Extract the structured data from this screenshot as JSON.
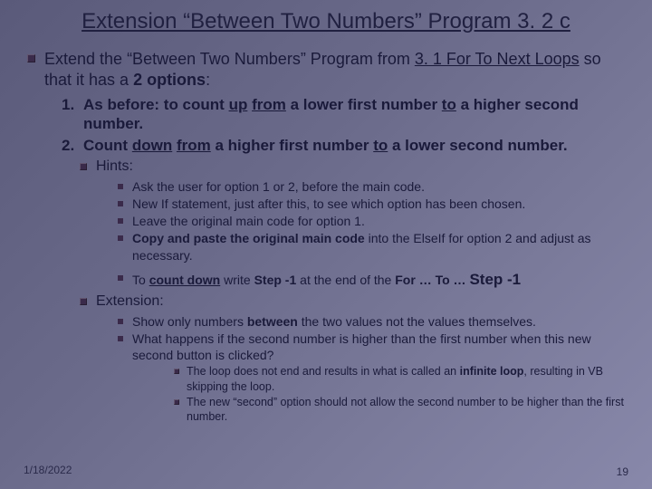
{
  "title": "Extension “Between Two Numbers” Program 3. 2 c",
  "intro": {
    "prefix": "Extend the “Between Two Numbers” Program from ",
    "link": "3. 1 For To Next Loops",
    "mid": " so that it has a ",
    "bold": "2 options",
    "suffix": ":"
  },
  "options": [
    {
      "num": "1.",
      "pre": "As before: to count ",
      "u1": "up",
      "sp1": " ",
      "u2": "from",
      "mid": " a lower first number ",
      "u3": "to",
      "post": " a higher second number."
    },
    {
      "num": "2.",
      "pre": "Count ",
      "u1": "down",
      "sp1": " ",
      "u2": "from",
      "mid": " a higher first number ",
      "u3": "to",
      "post": " a lower second number."
    }
  ],
  "hints_label": "Hints:",
  "hints": [
    {
      "text": "Ask the user for option 1 or 2, before the main code."
    },
    {
      "text": "New If statement, just after this, to see which option has been chosen."
    },
    {
      "text": "Leave the original main code for option 1."
    },
    {
      "html": "<b>Copy and paste the original main code</b> into the ElseIf for option 2 and adjust as necessary."
    }
  ],
  "hint_step": {
    "pre": "To ",
    "u": "count down",
    "mid": " write ",
    "b1": "Step -1",
    "mid2": " at the end of the ",
    "b2": "For … To … ",
    "big": "Step -1"
  },
  "ext_label": "Extension:",
  "extensions": [
    {
      "html": "Show only numbers <b>between</b> the two values not the values themselves."
    },
    {
      "html": "What happens if the second number is higher than the first number when this new second button is clicked?"
    }
  ],
  "deep": [
    {
      "html": "The loop does not end and results in what is called an <b>infinite loop</b>, resulting in VB skipping the loop."
    },
    {
      "html": "The new “second” option should not allow the second number to be higher than the first number."
    }
  ],
  "date": "1/18/2022",
  "page": "19"
}
